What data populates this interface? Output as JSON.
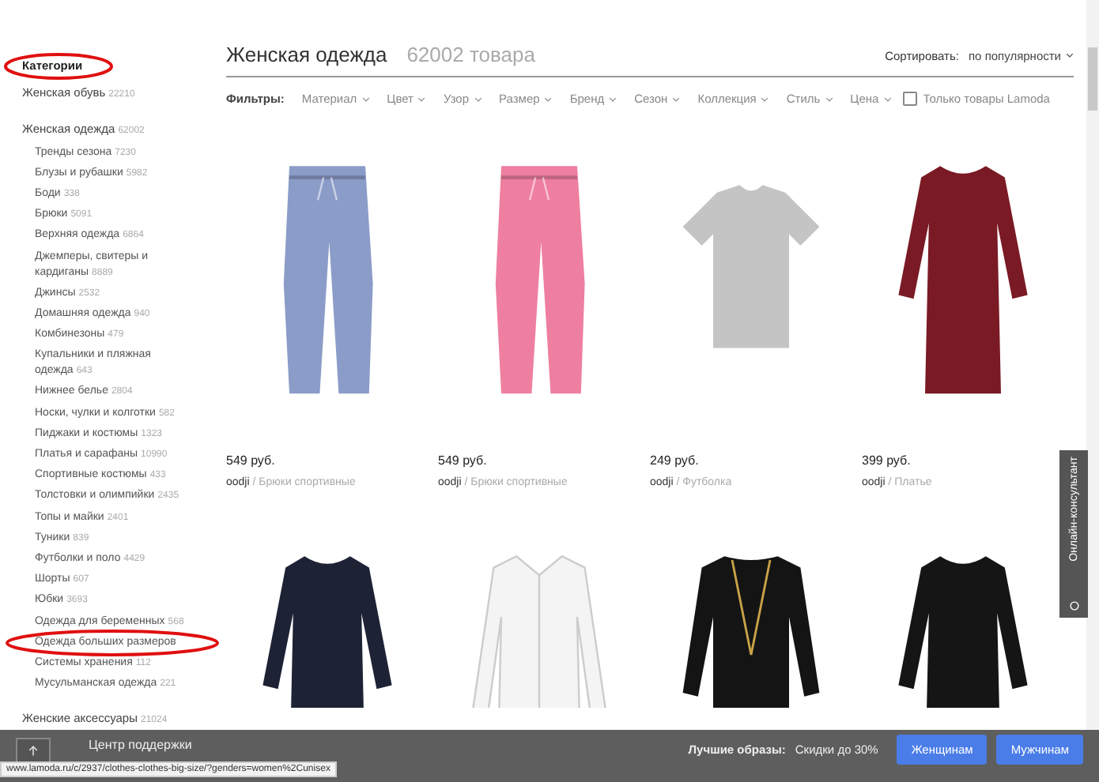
{
  "sidebar": {
    "heading": "Категории",
    "heading_circled": true,
    "categories": [
      {
        "label": "Женская обувь",
        "count": "22210"
      },
      {
        "label": "Женская одежда",
        "count": "62002",
        "children": [
          {
            "label": "Тренды сезона",
            "count": "7230"
          },
          {
            "label": "Блузы и рубашки",
            "count": "5982"
          },
          {
            "label": "Боди",
            "count": "338"
          },
          {
            "label": "Брюки",
            "count": "5091"
          },
          {
            "label": "Верхняя одежда",
            "count": "6864"
          },
          {
            "label": "Джемперы, свитеры и кардиганы",
            "count": "8889"
          },
          {
            "label": "Джинсы",
            "count": "2532"
          },
          {
            "label": "Домашняя одежда",
            "count": "940"
          },
          {
            "label": "Комбинезоны",
            "count": "479"
          },
          {
            "label": "Купальники и пляжная одежда",
            "count": "643"
          },
          {
            "label": "Нижнее белье",
            "count": "2804"
          },
          {
            "label": "Носки, чулки и колготки",
            "count": "582"
          },
          {
            "label": "Пиджаки и костюмы",
            "count": "1323"
          },
          {
            "label": "Платья и сарафаны",
            "count": "10990"
          },
          {
            "label": "Спортивные костюмы",
            "count": "433"
          },
          {
            "label": "Толстовки и олимпийки",
            "count": "2435"
          },
          {
            "label": "Топы и майки",
            "count": "2401"
          },
          {
            "label": "Туники",
            "count": "839"
          },
          {
            "label": "Футболки и поло",
            "count": "4429"
          },
          {
            "label": "Шорты",
            "count": "607"
          },
          {
            "label": "Юбки",
            "count": "3693"
          },
          {
            "label": "Одежда для беременных",
            "count": "568"
          },
          {
            "label": "Одежда больших размеров",
            "circled": true
          },
          {
            "label": "Системы хранения",
            "count": "112"
          },
          {
            "label": "Мусульманская одежда",
            "count": "221"
          }
        ]
      },
      {
        "label": "Женские аксессуары",
        "count": "21024"
      }
    ]
  },
  "header": {
    "title": "Женская одежда",
    "count": "62002 товара",
    "sort_label": "Сортировать:",
    "sort_value": "по популярности"
  },
  "filters": {
    "label": "Фильтры:",
    "items": [
      "Материал",
      "Цвет",
      "Узор",
      "Размер",
      "Бренд",
      "Сезон",
      "Коллекция",
      "Стиль",
      "Цена"
    ],
    "checkbox": {
      "label": "Только товары Lamoda",
      "checked": false
    }
  },
  "products": [
    {
      "kind": "pants",
      "color": "#8b9cc8",
      "price": "549 руб.",
      "brand": "oodji",
      "name": "/ Брюки спортивные"
    },
    {
      "kind": "pants",
      "color": "#ee7fa0",
      "price": "549 руб.",
      "brand": "oodji",
      "name": "/ Брюки спортивные"
    },
    {
      "kind": "tshirt",
      "color": "#c4c4c4",
      "price": "249 руб.",
      "brand": "oodji",
      "name": "/ Футболка"
    },
    {
      "kind": "dress",
      "color": "#7a1a24",
      "price": "399 руб.",
      "brand": "oodji",
      "name": "/ Платье"
    },
    {
      "kind": "dress",
      "color": "#1e2235"
    },
    {
      "kind": "shirt",
      "color": "#f4f4f4"
    },
    {
      "kind": "blouse",
      "color": "#141414"
    },
    {
      "kind": "dress",
      "color": "#151515"
    }
  ],
  "consultant": {
    "label": "Онлайн-консультант"
  },
  "footer": {
    "support": "Центр поддержки",
    "promo_label": "Лучшие образы:",
    "promo_text": "Скидки до 30%",
    "buttons": [
      "Женщинам",
      "Мужчинам"
    ]
  },
  "status_url": "www.lamoda.ru/c/2937/clothes-clothes-big-size/?genders=women%2Cunisex"
}
